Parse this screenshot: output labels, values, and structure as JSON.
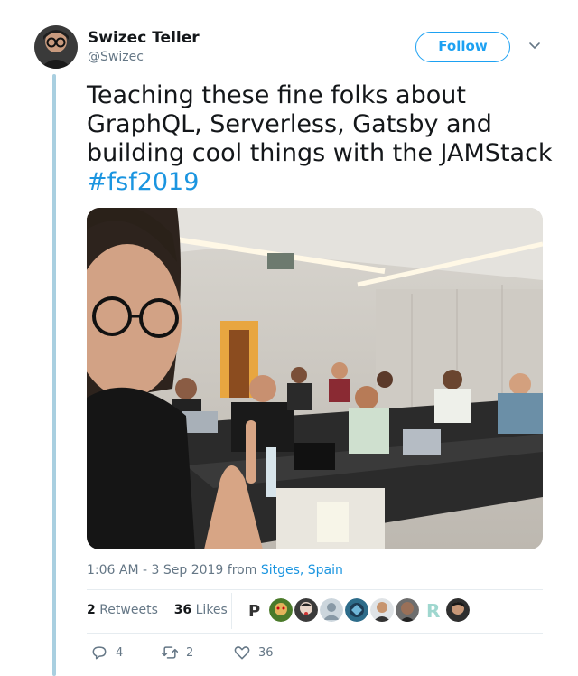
{
  "user": {
    "name": "Swizec Teller",
    "handle": "@Swizec"
  },
  "follow_label": "Follow",
  "tweet": {
    "text": "Teaching these fine folks about GraphQL, Serverless, Gatsby and building cool things with the JAMStack",
    "hashtag": "#fsf2019"
  },
  "meta": {
    "time": "1:06 AM - 3 Sep 2019 from",
    "location": "Sitges, Spain"
  },
  "stats": {
    "retweets_count": "2",
    "retweets_label": "Retweets",
    "likes_count": "36",
    "likes_label": "Likes"
  },
  "actions": {
    "replies": "4",
    "retweets": "2",
    "likes": "36"
  },
  "colors": {
    "accent": "#1da1f2",
    "link": "#1b95e0",
    "muted": "#657786",
    "thread_line": "#a9cfe0"
  },
  "icons": {
    "caret": "chevron-down-icon",
    "reply": "reply-icon",
    "retweet": "retweet-icon",
    "like": "heart-icon"
  }
}
